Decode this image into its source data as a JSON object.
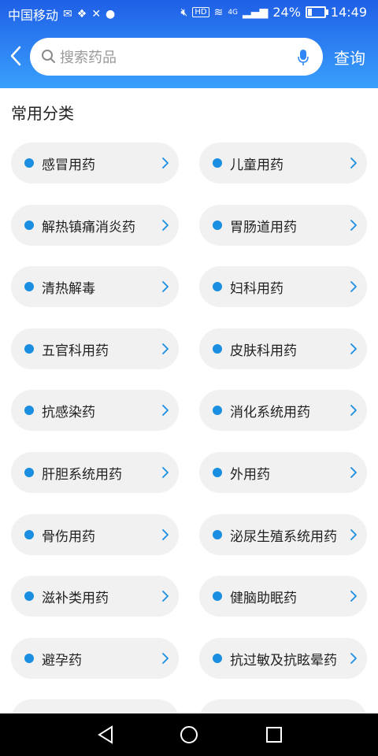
{
  "status_bar": {
    "carrier": "中国移动",
    "battery": "24%",
    "time": "14:49",
    "network_label": "4G",
    "hd_label": "HD"
  },
  "header": {
    "search_placeholder": "搜索药品",
    "query_label": "查询"
  },
  "section": {
    "title": "常用分类"
  },
  "categories": [
    "感冒用药",
    "儿童用药",
    "解热镇痛消炎药",
    "胃肠道用药",
    "清热解毒",
    "妇科用药",
    "五官科用药",
    "皮肤科用药",
    "抗感染药",
    "消化系统用药",
    "肝胆系统用药",
    "外用药",
    "骨伤用药",
    "泌尿生殖系统用药",
    "滋补类用药",
    "健脑助眠药",
    "避孕药",
    "抗过敏及抗眩晕药"
  ],
  "colors": {
    "header_blue": "#2f86f4",
    "dot_blue": "#1a8ee0",
    "pill_bg": "#f1f1f1",
    "chevron": "#1a8ee0"
  },
  "icons": {
    "back": "back-arrow-icon",
    "search": "search-icon",
    "mic": "microphone-icon",
    "chevron": "chevron-right-icon"
  }
}
